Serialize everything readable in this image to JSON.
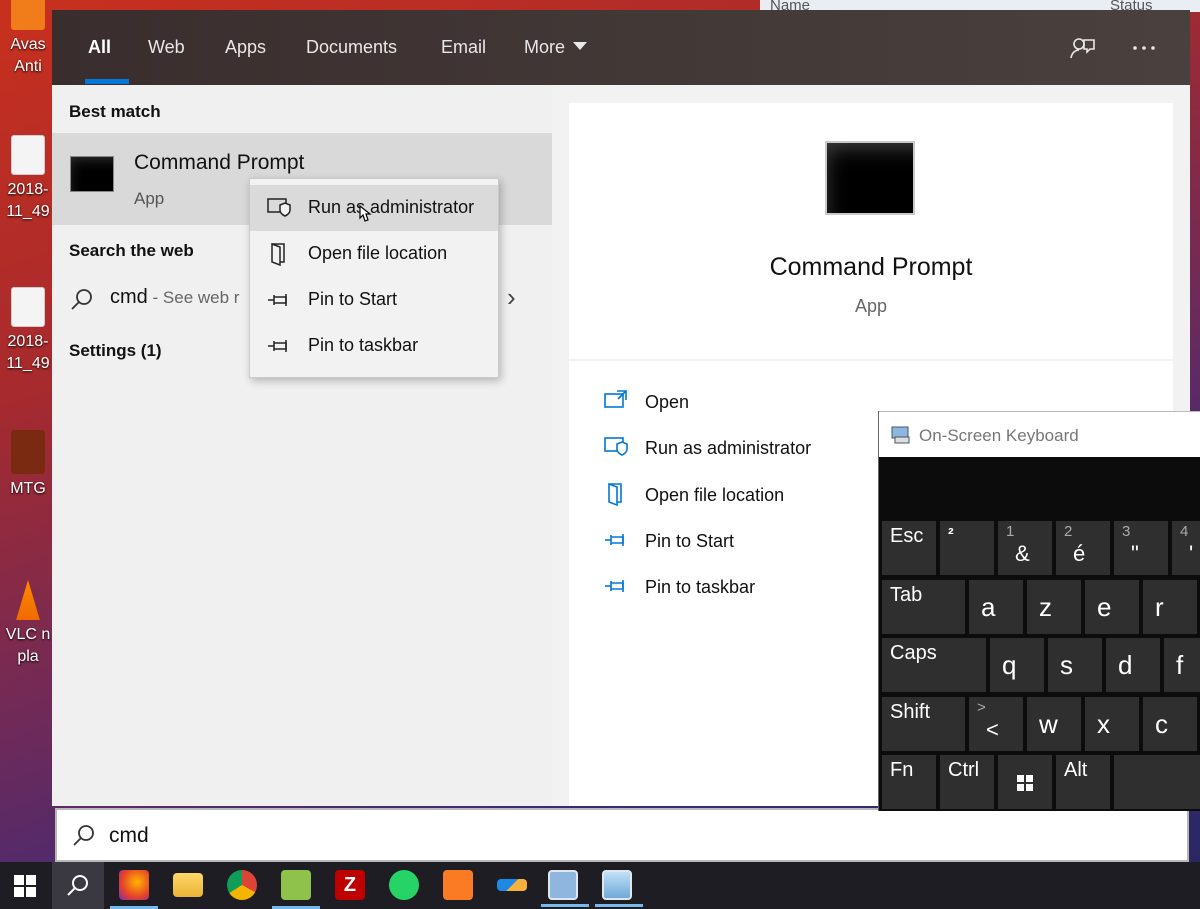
{
  "desktop": {
    "icons": [
      {
        "label": "Avas",
        "label2": "Anti"
      },
      {
        "label": "2018-",
        "label2": "11_49"
      },
      {
        "label": "2018-",
        "label2": "11_49"
      },
      {
        "label": "MTG",
        "label2": ""
      },
      {
        "label": "VLC n",
        "label2": "pla"
      }
    ],
    "bg_window_columns": {
      "name": "Name",
      "status": "Status"
    }
  },
  "search": {
    "tabs": [
      {
        "label": "All",
        "active": true
      },
      {
        "label": "Web"
      },
      {
        "label": "Apps"
      },
      {
        "label": "Documents"
      },
      {
        "label": "Email"
      },
      {
        "label": "More"
      }
    ],
    "best_match_header": "Best match",
    "best_match": {
      "title": "Command Prompt",
      "subtitle": "App"
    },
    "search_web_header": "Search the web",
    "web_suggestion": {
      "query": "cmd",
      "hint": " - See web r"
    },
    "settings_header": "Settings (1)",
    "context_menu": [
      {
        "label": "Run as administrator",
        "icon": "shield-icon"
      },
      {
        "label": "Open file location",
        "icon": "file-location-icon"
      },
      {
        "label": "Pin to Start",
        "icon": "pin-icon"
      },
      {
        "label": "Pin to taskbar",
        "icon": "pin-icon"
      }
    ],
    "preview": {
      "title": "Command Prompt",
      "subtitle": "App",
      "actions": [
        {
          "label": "Open",
          "icon": "open-icon"
        },
        {
          "label": "Run as administrator",
          "icon": "shield-icon"
        },
        {
          "label": "Open file location",
          "icon": "file-location-icon"
        },
        {
          "label": "Pin to Start",
          "icon": "pin-icon"
        },
        {
          "label": "Pin to taskbar",
          "icon": "pin-icon"
        }
      ]
    },
    "query": "cmd",
    "accent_color": "#0078d7"
  },
  "osk": {
    "title": "On-Screen Keyboard",
    "row1": [
      {
        "label": "Esc"
      },
      {
        "top": "",
        "main": "²"
      },
      {
        "top": "1",
        "main": "&"
      },
      {
        "top": "2",
        "main": "é"
      },
      {
        "top": "3",
        "main": "\""
      },
      {
        "top": "4",
        "main": "'"
      }
    ],
    "row2": [
      "Tab",
      "a",
      "z",
      "e",
      "r"
    ],
    "row3": [
      "Caps",
      "q",
      "s",
      "d",
      "f"
    ],
    "row4": [
      {
        "label": "Shift"
      },
      {
        "top": ">",
        "main": "<"
      },
      {
        "label": "w"
      },
      {
        "label": "x"
      },
      {
        "label": "c"
      }
    ],
    "row5": [
      "Fn",
      "Ctrl",
      "windows-icon",
      "Alt",
      ""
    ]
  },
  "taskbar": {
    "apps": [
      "start-icon",
      "search-icon",
      "firefox-icon",
      "file-explorer-icon",
      "chrome-icon",
      "notepad-plus-icon",
      "filezilla-icon",
      "whatsapp-icon",
      "xampp-icon",
      "app-icon",
      "on-screen-keyboard-icon",
      "remote-desktop-icon"
    ]
  }
}
